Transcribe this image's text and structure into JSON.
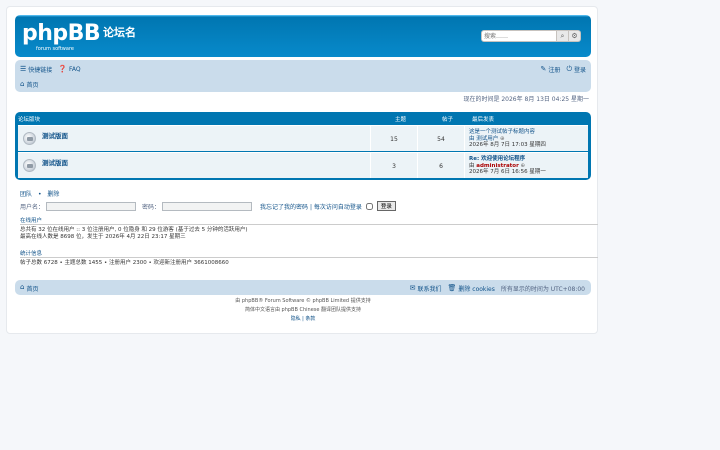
{
  "header": {
    "logo_text": "phpBB",
    "logo_subtext": "forum  software",
    "site_name": "论坛名",
    "search_placeholder": "搜索……"
  },
  "nav": {
    "quick_links": "快捷链接",
    "faq": "FAQ",
    "register": "注册",
    "login": "登录",
    "board_index": "首页"
  },
  "current_time": "现在的时间是 2026年 8月 13日 04:25 星期一",
  "forum_table": {
    "headers": {
      "forum": "论坛版块",
      "topics": "主题",
      "posts": "帖子",
      "last_post": "最后发表"
    },
    "rows": [
      {
        "title": "测试版面",
        "topics": "15",
        "posts": "54",
        "last_line1": "这是一个测试帖子标题内容",
        "last_by": "由 测试用户",
        "last_time": "2026年 8月 7日 17:03 星期四"
      },
      {
        "title": "测试版面",
        "topics": "3",
        "posts": "6",
        "last_line1": "Re: 欢迎使用论坛程序",
        "last_by_prefix": "由",
        "last_by_user": "administrator",
        "last_time": "2026年 7月 6日 16:56 星期一"
      }
    ]
  },
  "links": {
    "a": "团队",
    "sep": "•",
    "b": "删除"
  },
  "login_form": {
    "username_label": "用户名：",
    "password_label": "密码：",
    "forgot": "我忘记了我的密码 | 每次访问自动登录",
    "submit": "登录"
  },
  "online": {
    "title": "在线用户",
    "line1": "总共有 32 位在线用户 :: 3 位注册用户, 0 位隐身 和 29 位游客 (基于过去 5 分钟的活跃用户)",
    "line2": "最高在线人数是 8698 位，发生于 2026年 4月 22日 23:17 星期三"
  },
  "stats": {
    "title": "统计信息",
    "line": "帖子总数 6728 • 主题总数 1455 • 注册用户 2300 • 欢迎新注册用户 3661008660"
  },
  "footer": {
    "index": "首页",
    "contact": "联系我们",
    "cookies": "删除 cookies",
    "timezone": "所有显示的时间为 UTC+08:00",
    "powered": "由 phpBB® Forum Software © phpBB Limited 提供支持",
    "translation": "简体中文语言由 phpBB Chinese 翻译团队提供支持",
    "links": "隐私 | 条款"
  }
}
